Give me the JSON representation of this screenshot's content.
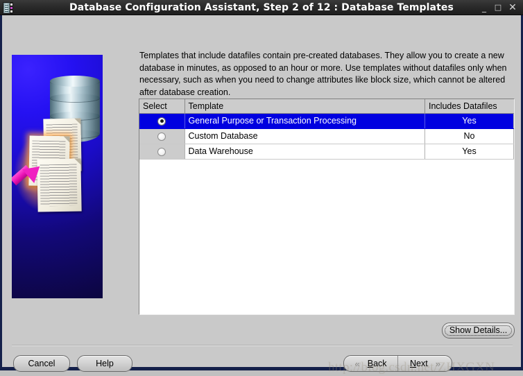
{
  "window": {
    "title": "Database Configuration Assistant, Step 2 of 12 : Database Templates",
    "icon": "app-icon",
    "controls": {
      "minimize": "_",
      "maximize": "□",
      "close": "✕"
    }
  },
  "sidebar": {
    "graphic": "database-templates-illustration"
  },
  "main": {
    "description": "Templates that include datafiles contain pre-created databases. They allow you to create a new database in minutes, as opposed to an hour or more. Use templates without datafiles only when necessary, such as when you need to change attributes like block size, which cannot be altered after database creation.",
    "table": {
      "columns": [
        "Select",
        "Template",
        "Includes Datafiles"
      ],
      "rows": [
        {
          "selected": true,
          "template": "General Purpose or Transaction Processing",
          "includes_datafiles": "Yes"
        },
        {
          "selected": false,
          "template": "Custom Database",
          "includes_datafiles": "No"
        },
        {
          "selected": false,
          "template": "Data Warehouse",
          "includes_datafiles": "Yes"
        }
      ]
    }
  },
  "buttons": {
    "show_details": "Show Details...",
    "cancel": "Cancel",
    "help": "Help",
    "back": "Back",
    "back_mnemonic": "B",
    "back_rest": "ack",
    "next": "Next",
    "next_mnemonic": "N",
    "next_rest": "ext",
    "chevron_left": "«",
    "chevron_right": "»"
  },
  "watermark": {
    "text": "http://blog.csdn.net/ZHXGXN"
  },
  "colors": {
    "titlebar": "#2c2c2c",
    "window_frame": "#14204a",
    "client_bg": "#c9c9c9",
    "selection_blue": "#0000e0",
    "sidebar_blue": "#2511f2",
    "arrow_magenta": "#f021c1"
  }
}
